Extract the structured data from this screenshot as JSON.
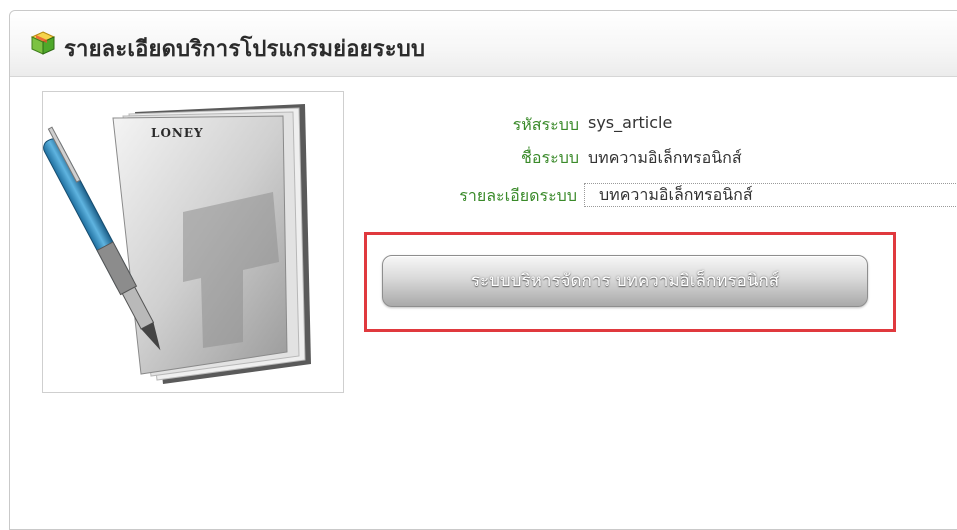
{
  "panel": {
    "title": "รายละเอียดบริการโปรแกรมย่อยระบบ",
    "icon": "cube-box-icon"
  },
  "system_info": {
    "code_label": "รหัสระบบ",
    "code_value": "sys_article",
    "name_label": "ชื่อระบบ",
    "name_value": "บทความอิเล็กทรอนิกส์",
    "description_label": "รายละเอียดระบบ",
    "description_value": "บทความอิเล็กทรอนิกส์"
  },
  "thumbnail": {
    "icon": "book-and-pen-icon",
    "logo_text": "LONEY"
  },
  "actions": {
    "manage_button_label": "ระบบบริหารจัดการ บทความอิเล็กทรอนิกส์"
  },
  "colors": {
    "label_green": "#3a8a2a",
    "highlight_red": "#e0393e"
  }
}
